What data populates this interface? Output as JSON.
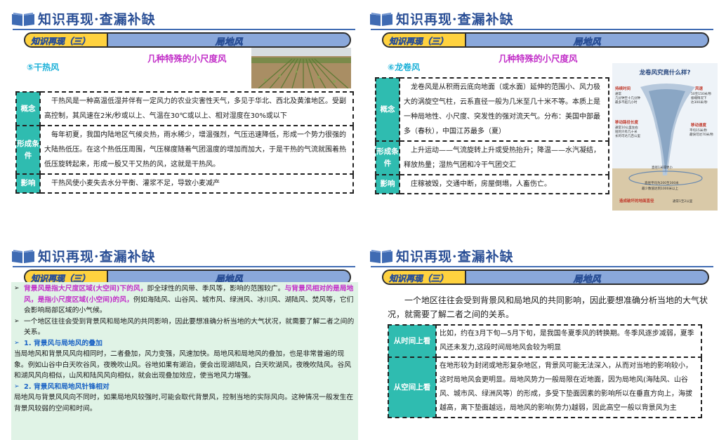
{
  "header": {
    "title": "知识再现·查漏补缺",
    "banner_left": "知识再现（三）",
    "banner_right": "局地风"
  },
  "panel1": {
    "subtitle": "几种特殊的小尺度风",
    "item_label": "⑤干热风",
    "rows": [
      {
        "label": "概念",
        "text": "干热风是一种高温低湿并伴有一定风力的农业灾害性天气，多见于华北、西北及黄淮地区。受副高控制，其风速在2米/秒或以上、气温在30℃或以上、相对湿度在30%或以下"
      },
      {
        "label": "形成条件",
        "text": "每年初夏，我国内陆地区气候炎热，雨水稀少，增温强烈，气压迅速降低，形成一个势力很强的大陆热低压。在这个热低压周围，气压梯度随着气团温度的增加而加大，于是干热的气流就围着热低压旋转起来，形成一股又干又热的风，这就是干热风。"
      },
      {
        "label": "影响",
        "text": "干热风使小麦失去水分平衡、灌浆不足，导致小麦减产"
      }
    ]
  },
  "panel2": {
    "subtitle": "几种特殊的小尺度风",
    "item_label": "⑥龙卷风",
    "rows": [
      {
        "label": "概念",
        "text": "龙卷风是从积雨云底向地面（或水面）延伸的范围小、风力极大的涡旋空气柱，云系直径一般为几米至几十米不等。本质上是一种局地性、小尺度、突发性的强对流天气。分布：美国中部最多（春秋），中国江苏最多（夏）"
      },
      {
        "label": "形成条件",
        "text": "上升运动——气流旋转上升或受热抬升；降温——水汽凝结，释放热量；湿热气团和冷干气团交汇"
      },
      {
        "label": "影响",
        "text": "庄稼被毁，交通中断，房屋倒塌，人畜伤亡。"
      }
    ],
    "infographic": {
      "title": "龙卷风究竟什么样?",
      "l1": "持续时间",
      "l1b": "通常",
      "l1c": "几分钟至十几分钟",
      "l1d": "最多不超几小时",
      "r1": "风速",
      "r1b": "50至150米/秒",
      "r1c": "极端情况下",
      "r1d": "达300米/秒",
      "l2": "移动路径长度",
      "l2b": "通常10公里左右",
      "l2c": "短的只有几十米",
      "l2d": "长的可达几百公里",
      "r2": "移动速度",
      "r2b": "平均15米/秒",
      "r2c": "最快可达70米/秒",
      "c1": "直径1米或更小",
      "c2": "直径平均为200至300米",
      "c3": "最少数值达到1000米以上",
      "footer": "造成破坏的地面直径",
      "footer2": "通常1至2公里"
    }
  },
  "panel3": {
    "p1_pink": "背景风是指大尺度区域(大空间)下的风，",
    "p1_mid": "即全球性的风带、季风等，影响的范围较广。",
    "p1_pink2": "与背景风相对的是局地风，是指小尺度区域(小空间)的风，",
    "p1_end": "例如海陆风、山谷风、城市风、绿洲风、冰川风、湖陆风、焚风等，它们会影响局部区域的小气候。",
    "p2": "一个地区往往会受到背景风和局地风的共同影响，因此要想准确分析当地的大气状况，就需要了解二者之间的关系。",
    "h1": "1. 背景风与局地风的叠加",
    "t1": "当局地风和背景风风向相同时，二者叠加，风力变强，风速加快。局地风和局地风的叠加，也是非常普遍的现象。例如山谷中白天吹谷风，夜晚吹山风。谷地如果有湖泊，便会出现湖陆风，白天吹湖风，夜晚吹陆风。谷风和湖风风向相似，山风和陆风风向相似，就会出现叠加效应，使当地风力增强。",
    "h2": "2. 背景风和局地风针锋相对",
    "t2": "局地风与背景风风向不同时，如果局地风较强时,可能会取代背景风，控制当地的实际风向。这种情况一般发生在背景风较弱的空间和时间。"
  },
  "panel4": {
    "intro": "一个地区往往会受到背景风和局地风的共同影响，因此要想准确分析当地的大气状况，就需要了解二者之间的关系。",
    "rows": [
      {
        "label": "从时间上看",
        "text": "比如，约在3月下旬—5月下旬，是我国冬夏季风的转换期。冬季风逐步减弱，夏季风还未发力,这段时间局地风会较为明显"
      },
      {
        "label": "从空间上看",
        "text": "在地形较为封闭或地形复杂地区，背景风可能无法深入，从而对当地的影响较小，这时局地风会更明显。局地风势力一般局限在近地面，因为局地风(海陆风、山谷风、城市风、绿洲风等）的形成，多受下垫面因素的影响所以在垂直方向上，海拔越高，离下垫面越远，局地风的影响(势力)越弱，因此高空一般以背景风为主"
      }
    ]
  }
}
